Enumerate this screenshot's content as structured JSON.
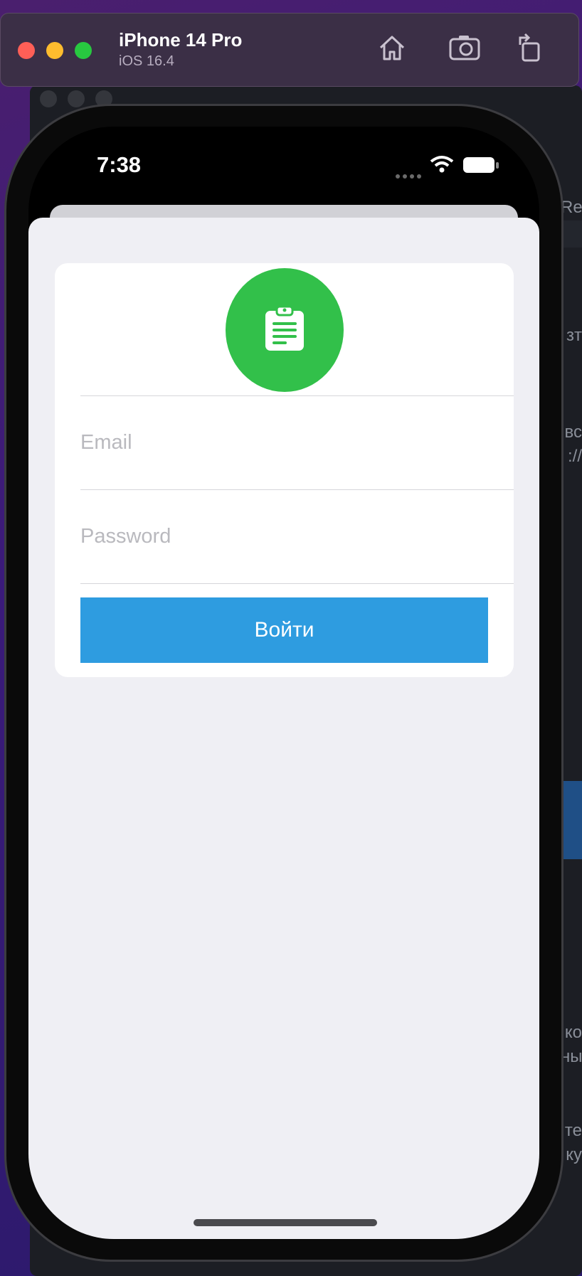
{
  "simulator": {
    "device_name": "iPhone 14 Pro",
    "os_version": "iOS 16.4"
  },
  "status_bar": {
    "time": "7:38"
  },
  "login": {
    "email_placeholder": "Email",
    "password_placeholder": "Password",
    "submit_label": "Войти"
  },
  "background_text": [
    "Re",
    "зт",
    "вс",
    "://",
    "ко",
    "ны",
    "те",
    "ку"
  ],
  "colors": {
    "accent_green": "#32c04a",
    "button_blue": "#2e9ce0",
    "sheet_background": "#efeff4"
  },
  "icons": [
    "home-icon",
    "screenshot-icon",
    "rotate-icon",
    "clipboard-icon",
    "wifi-icon",
    "battery-icon"
  ]
}
